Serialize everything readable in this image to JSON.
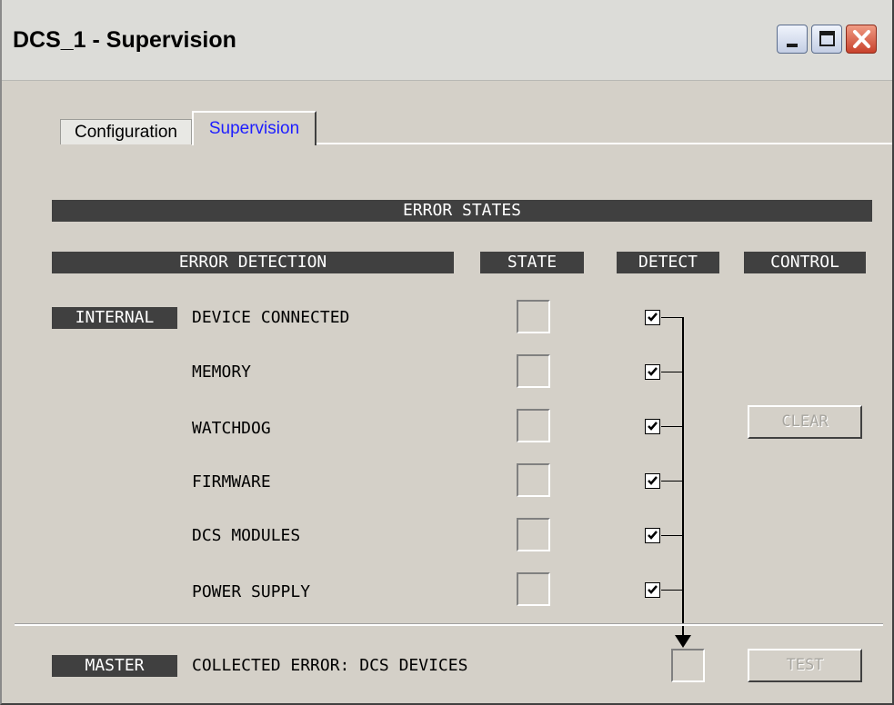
{
  "window": {
    "title": "DCS_1 - Supervision"
  },
  "tabs": [
    {
      "label": "Configuration",
      "active": false
    },
    {
      "label": "Supervision",
      "active": true
    }
  ],
  "headers": {
    "error_states": "ERROR STATES",
    "error_detection": "ERROR DETECTION",
    "state": "STATE",
    "detect": "DETECT",
    "control": "CONTROL"
  },
  "internal_tag": "INTERNAL",
  "master_tag": "MASTER",
  "errors": [
    {
      "name": "DEVICE CONNECTED",
      "detect": true
    },
    {
      "name": "MEMORY",
      "detect": true
    },
    {
      "name": "WATCHDOG",
      "detect": true
    },
    {
      "name": "FIRMWARE",
      "detect": true
    },
    {
      "name": "DCS MODULES",
      "detect": true
    },
    {
      "name": "POWER SUPPLY",
      "detect": true
    }
  ],
  "master": {
    "label": "COLLECTED ERROR: DCS DEVICES"
  },
  "buttons": {
    "clear": "CLEAR",
    "test": "TEST"
  },
  "colors": {
    "header_bg": "#404040",
    "panel_bg": "#d4d0c8",
    "active_tab_text": "#1e1eff",
    "disabled_text": "#a8a6a0"
  }
}
